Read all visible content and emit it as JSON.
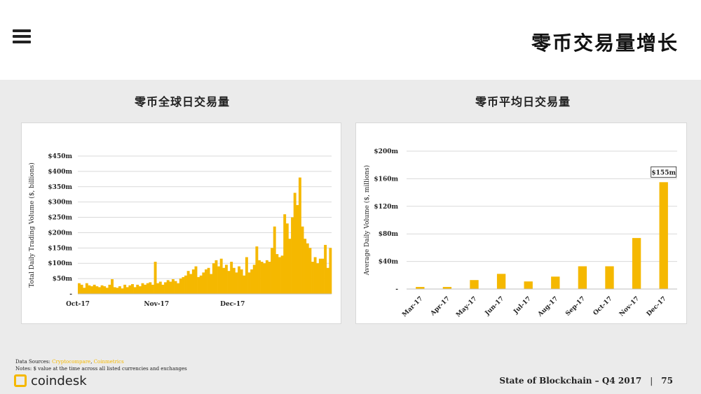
{
  "header": {
    "title": "零币交易量增长",
    "menu_icon": "hamburger-menu-icon"
  },
  "panels": [
    {
      "title": "零币全球日交易量"
    },
    {
      "title": "零币平均日交易量"
    }
  ],
  "colors": {
    "bar": "#f5b800",
    "grid": "#d9d9d9",
    "text": "#222222"
  },
  "chart_data": [
    {
      "type": "bar",
      "title": "零币全球日交易量",
      "ylabel": "Total Daily Trading Volume ($, billions)",
      "xlabel": "",
      "ylim": [
        0,
        450
      ],
      "yticks": [
        0,
        50,
        100,
        150,
        200,
        250,
        300,
        350,
        400,
        450
      ],
      "ytick_labels": [
        "-",
        "$50m",
        "$100m",
        "$150m",
        "$200m",
        "$250m",
        "$300m",
        "$350m",
        "$400m",
        "$450m"
      ],
      "x_tick_labels": [
        {
          "label": "Oct-17",
          "index": 0
        },
        {
          "label": "Nov-17",
          "index": 31
        },
        {
          "label": "Dec-17",
          "index": 61
        }
      ],
      "values": [
        35,
        30,
        20,
        35,
        28,
        25,
        30,
        25,
        22,
        28,
        25,
        20,
        30,
        48,
        22,
        20,
        25,
        18,
        30,
        22,
        28,
        32,
        22,
        30,
        25,
        35,
        30,
        35,
        38,
        30,
        105,
        35,
        40,
        30,
        38,
        45,
        40,
        48,
        42,
        35,
        50,
        55,
        60,
        75,
        65,
        80,
        90,
        55,
        60,
        70,
        80,
        85,
        65,
        100,
        110,
        90,
        115,
        85,
        95,
        75,
        105,
        85,
        70,
        90,
        80,
        60,
        120,
        70,
        80,
        95,
        155,
        110,
        105,
        100,
        110,
        105,
        150,
        220,
        130,
        120,
        125,
        260,
        230,
        180,
        250,
        330,
        290,
        380,
        220,
        180,
        165,
        150,
        105,
        120,
        100,
        115,
        115,
        160,
        85,
        150
      ]
    },
    {
      "type": "bar",
      "title": "零币平均日交易量",
      "ylabel": "Average Daily Volume ($, millions)",
      "xlabel": "",
      "ylim": [
        0,
        200
      ],
      "yticks": [
        0,
        40,
        80,
        120,
        160,
        200
      ],
      "ytick_labels": [
        "-",
        "$40m",
        "$80m",
        "$120m",
        "$160m",
        "$200m"
      ],
      "categories": [
        "Mar-17",
        "Apr-17",
        "May-17",
        "Jun-17",
        "Jul-17",
        "Aug-17",
        "Sep-17",
        "Oct-17",
        "Nov-17",
        "Dec-17"
      ],
      "values": [
        3,
        3,
        13,
        22,
        11,
        18,
        33,
        33,
        74,
        155
      ],
      "annotations": [
        {
          "category": "Dec-17",
          "text": "$155m"
        }
      ]
    }
  ],
  "footer": {
    "sources_label": "Data Sources: ",
    "source_1": "Cryptocompare",
    "source_sep": ", ",
    "source_2": "Coinmetrics",
    "notes": "Notes: $ value at the time across all listed currencies and exchanges",
    "logo_text": "coindesk",
    "report_title": "State of Blockchain – Q4 2017",
    "separator": "|",
    "page_number": "75"
  }
}
